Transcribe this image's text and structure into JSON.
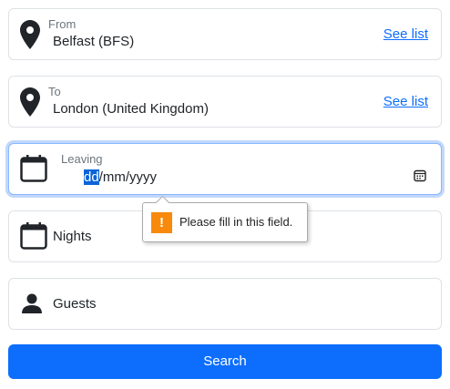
{
  "from": {
    "label": "From",
    "value": "Belfast (BFS)",
    "link": "See list"
  },
  "to": {
    "label": "To",
    "value": "London (United Kingdom)",
    "link": "See list"
  },
  "leaving": {
    "label": "Leaving",
    "date_selected": "dd",
    "date_rest": "/mm/yyyy"
  },
  "validation": {
    "message": "Please fill in this field.",
    "icon": "!"
  },
  "nights": {
    "label": "Nights"
  },
  "guests": {
    "label": "Guests"
  },
  "search": {
    "label": "Search"
  },
  "colors": {
    "primary": "#0d6efd",
    "warning": "#f7890c"
  }
}
